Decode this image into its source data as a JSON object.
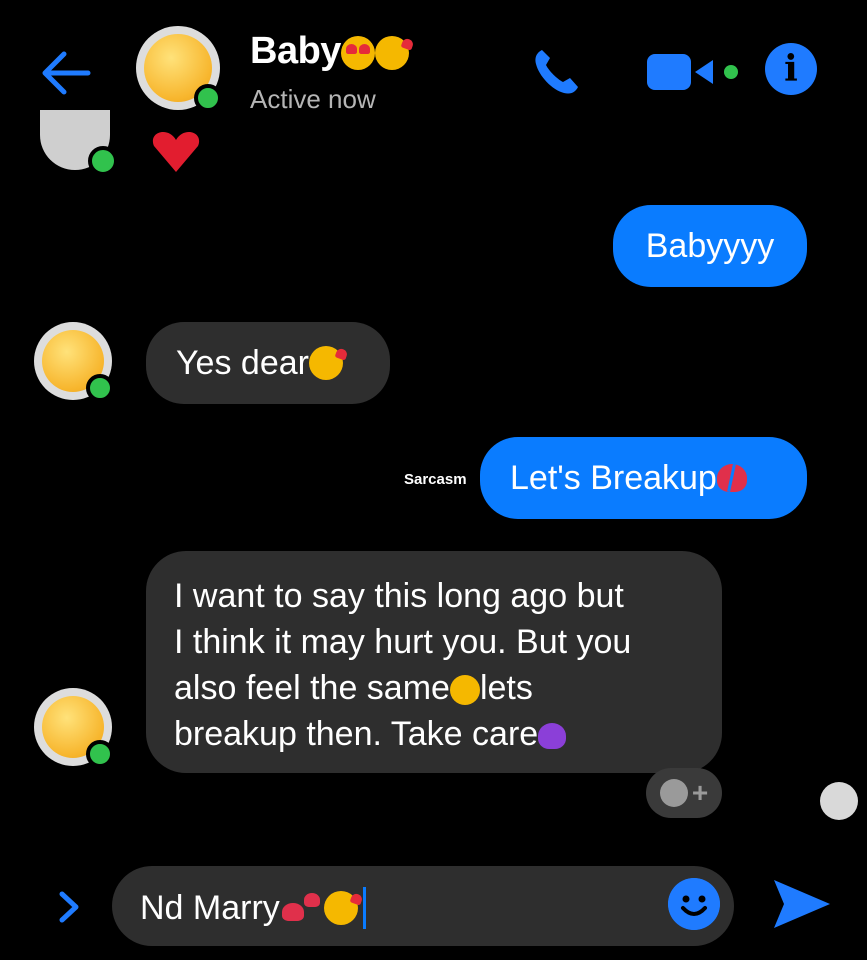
{
  "header": {
    "contact_name": "Baby",
    "status": "Active now",
    "icons": [
      "back-arrow-icon",
      "phone-icon",
      "video-camera-icon",
      "info-icon"
    ],
    "info_glyph": "i"
  },
  "messages": [
    {
      "direction": "sent",
      "text": "Babyyyy"
    },
    {
      "direction": "received",
      "text": "Yes dear"
    },
    {
      "direction": "sent",
      "text": "Let's Breakup",
      "annotation": "Sarcasm"
    },
    {
      "direction": "received",
      "lines": [
        "I want to say this long ago but",
        "I think it may hurt you. But you",
        "also feel the same",
        "lets",
        "breakup then. Take care"
      ]
    }
  ],
  "composer": {
    "value": "Nd Marry"
  },
  "reaction": {
    "add_label": "+"
  },
  "colors": {
    "background": "#000000",
    "sent_bubble": "#0a7cff",
    "received_bubble": "#2e2e2e",
    "accent": "#1f7bff",
    "active_dot": "#31c24d",
    "status_text": "#b5b5b5"
  }
}
